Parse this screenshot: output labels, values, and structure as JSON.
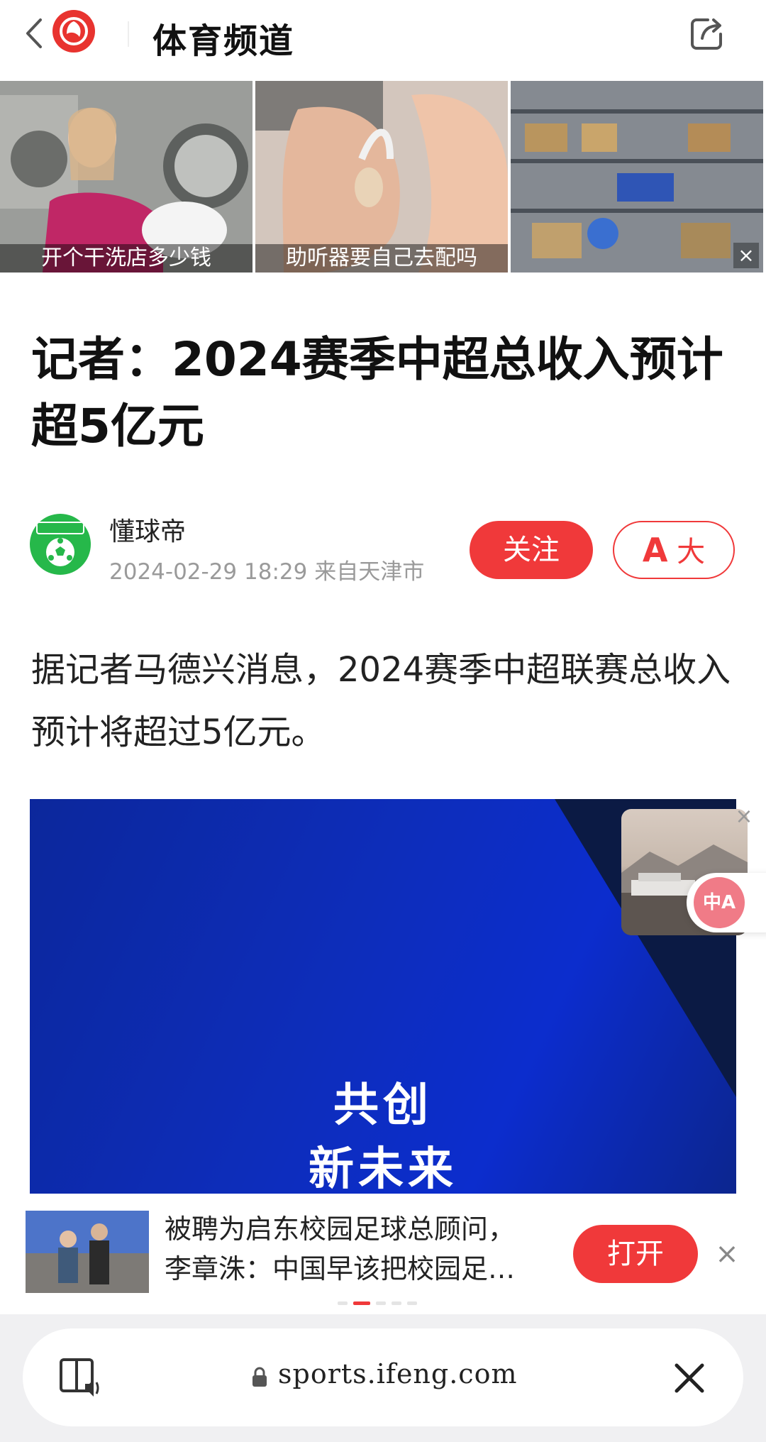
{
  "header": {
    "title": "体育频道",
    "logo_icon": "ifeng-logo-icon",
    "back_icon": "chevron-left-icon",
    "share_icon": "share-icon"
  },
  "ads": [
    {
      "caption": "开个干洗店多少钱"
    },
    {
      "caption": "助听器要自己去配吗"
    },
    {
      "caption": ""
    }
  ],
  "ad_close": "×",
  "article": {
    "title": "记者：2024赛季中超总收入预计超5亿元",
    "author": "懂球帝",
    "meta": "2024-02-29 18:29 来自天津市",
    "follow_label": "关注",
    "font_label_a": "A",
    "font_label_big": "大",
    "body": "据记者马德兴消息，2024赛季中超联赛总收入预计将超过5亿元。",
    "hero_line1": "共创",
    "hero_line2": "新未来"
  },
  "float_video": {
    "close": "×",
    "translate_label": "中A"
  },
  "recommendation": {
    "text_line1": "被聘为启东校园足球总顾问，",
    "text_line2": "李章洙：中国早该把校园足…",
    "open_label": "打开",
    "close": "×"
  },
  "browser": {
    "url": "sports.ifeng.com"
  },
  "colors": {
    "accent": "#f0393a",
    "hero_blue": "#0d2bb0",
    "avatar_green": "#26b84a"
  }
}
